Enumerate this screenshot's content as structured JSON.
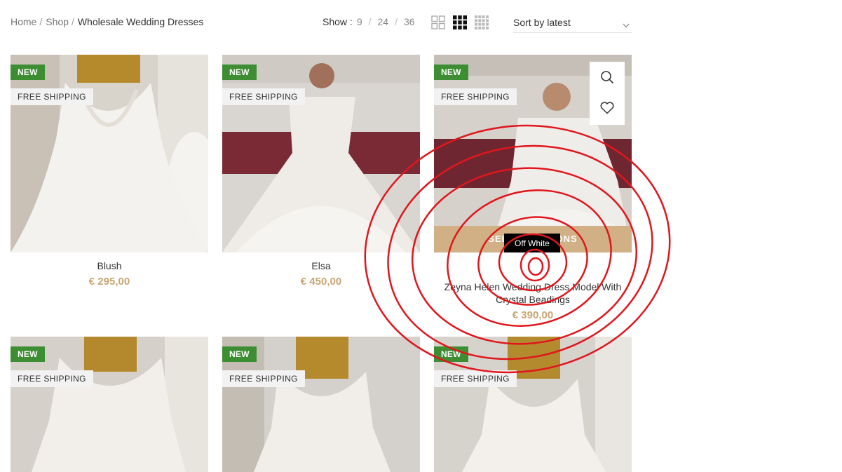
{
  "breadcrumb": {
    "home": "Home",
    "shop": "Shop",
    "sep": "/",
    "current": "Wholesale Wedding Dresses"
  },
  "show": {
    "label": "Show :",
    "opt_9": "9",
    "opt_24": "24",
    "opt_36": "36",
    "sep": "/"
  },
  "sort": {
    "label": "Sort by latest"
  },
  "badges": {
    "new": "NEW",
    "shipping": "FREE SHIPPING"
  },
  "product_actions": {
    "select_options": "SELECT OPTIONS",
    "swatch_tooltip": "Off White"
  },
  "products": [
    {
      "name": "Blush",
      "price": "€ 295,00"
    },
    {
      "name": "Elsa",
      "price": "€ 450,00"
    },
    {
      "name": "Zeyna Helen Wedding Dress Model With Crystal Beadings",
      "price": "€ 390,00"
    },
    {
      "name": "",
      "price": ""
    },
    {
      "name": "",
      "price": ""
    },
    {
      "name": "",
      "price": ""
    }
  ],
  "colors": {
    "badge_new": "#3d8d33",
    "price": "#c8a573",
    "select_bar": "#d0b084",
    "annotation": "#e0161c"
  },
  "icons": [
    "chevron-down-icon",
    "grid-2-icon",
    "grid-3-icon",
    "grid-4-icon",
    "search-icon",
    "heart-icon"
  ]
}
